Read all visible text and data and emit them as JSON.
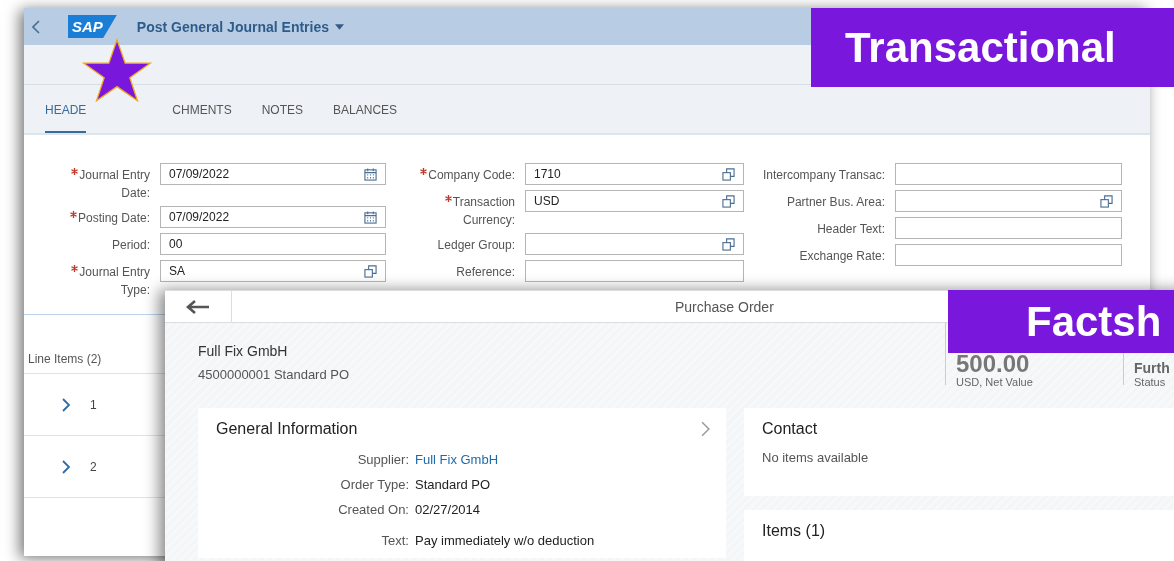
{
  "journal_window": {
    "logo": "SAP",
    "title": "Post General Journal Entries",
    "tabs": [
      {
        "label": "HEADE",
        "selected": true
      },
      {
        "label": "CHMENTS",
        "selected": false
      },
      {
        "label": "NOTES",
        "selected": false
      },
      {
        "label": "BALANCES",
        "selected": false
      }
    ],
    "form_columns": [
      [
        {
          "label": "Journal Entry Date:",
          "required": true,
          "value": "07/09/2022",
          "kind": "date"
        },
        {
          "label": "Posting Date:",
          "required": true,
          "value": "07/09/2022",
          "kind": "date"
        },
        {
          "label": "Period:",
          "required": false,
          "value": "00",
          "kind": "plain"
        },
        {
          "label": "Journal Entry Type:",
          "required": true,
          "value": "SA",
          "kind": "lookup"
        }
      ],
      [
        {
          "label": "Company Code:",
          "required": true,
          "value": "1710",
          "kind": "lookup"
        },
        {
          "label": "Transaction Currency:",
          "required": true,
          "value": "USD",
          "kind": "lookup"
        },
        {
          "label": "Ledger Group:",
          "required": false,
          "kind": "lookup"
        },
        {
          "label": "Reference:",
          "required": false,
          "kind": "plain"
        }
      ],
      [
        {
          "label": "Intercompany Transac:",
          "required": false,
          "kind": "plain"
        },
        {
          "label": "Partner Bus. Area:",
          "required": false,
          "kind": "lookup"
        },
        {
          "label": "Header Text:",
          "required": false,
          "kind": "plain"
        },
        {
          "label": "Exchange Rate:",
          "required": false,
          "kind": "plain"
        }
      ]
    ],
    "line_items": {
      "title": "Line Items (2)",
      "rows": [
        {
          "number": "1"
        },
        {
          "number": "2"
        }
      ]
    }
  },
  "factsheet_window": {
    "title": "Purchase Order",
    "header": {
      "title": "Full Fix GmbH",
      "subtitle": "4500000001 Standard PO"
    },
    "kpis": [
      {
        "value": "500.00",
        "label": "USD, Net Value"
      },
      {
        "value": "Furth",
        "label": "Status"
      }
    ],
    "general_information": {
      "title": "General Information",
      "fields": [
        {
          "label": "Supplier:",
          "value": "Full Fix GmbH",
          "kind": "link"
        },
        {
          "label": "Order Type:",
          "value": "Standard PO",
          "kind": "text"
        },
        {
          "label": "Created On:",
          "value": "02/27/2014",
          "kind": "text"
        },
        {
          "label": "Text:",
          "value": "Pay immediately w/o deduction",
          "kind": "text"
        }
      ]
    },
    "contact": {
      "title": "Contact",
      "message": "No items available"
    },
    "items": {
      "title": "Items (1)"
    }
  },
  "banners": [
    {
      "text": "Transactional"
    },
    {
      "text": "Factsh"
    }
  ]
}
